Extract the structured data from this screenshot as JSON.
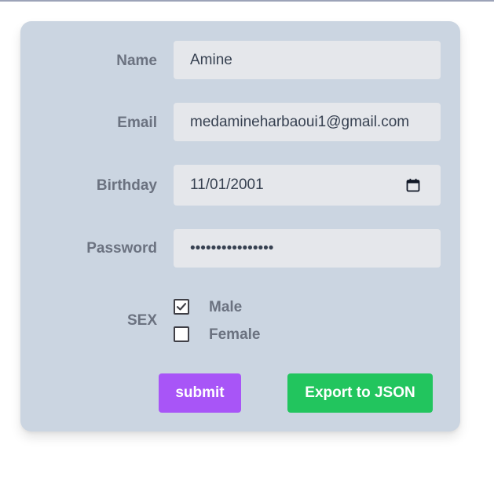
{
  "form": {
    "name": {
      "label": "Name",
      "value": "Amine"
    },
    "email": {
      "label": "Email",
      "value": "medamineharbaoui1@gmail.com"
    },
    "birthday": {
      "label": "Birthday",
      "value": "11/01/2001"
    },
    "password": {
      "label": "Password",
      "value": "••••••••••••••••"
    },
    "sex": {
      "label": "SEX",
      "options": [
        {
          "label": "Male",
          "checked": true
        },
        {
          "label": "Female",
          "checked": false
        }
      ]
    },
    "buttons": {
      "submit": "submit",
      "export": "Export to JSON"
    }
  },
  "colors": {
    "card_bg": "#cbd5e1",
    "field_bg": "#e5e7eb",
    "submit_bg": "#a855f7",
    "export_bg": "#22c55e",
    "label_text": "#6b7280"
  }
}
